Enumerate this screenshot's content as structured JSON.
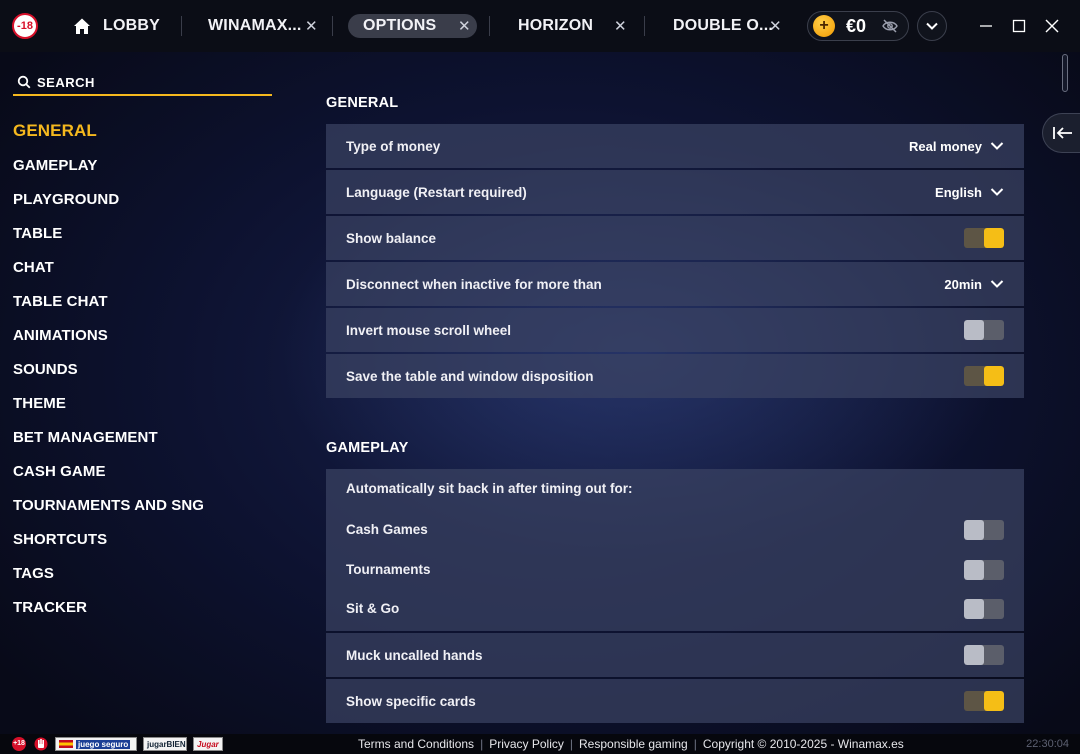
{
  "topbar": {
    "age_badge": "-18",
    "tabs": [
      {
        "label": "LOBBY",
        "icon": "home-icon",
        "closable": false
      },
      {
        "label": "WINAMAX...",
        "closable": true
      },
      {
        "label": "OPTIONS",
        "closable": true,
        "active": true
      },
      {
        "label": "HORIZON",
        "closable": true
      },
      {
        "label": "DOUBLE O...",
        "closable": true
      }
    ],
    "close_glyph": "✕",
    "wallet": {
      "coin_symbol": "+",
      "balance": "€0"
    },
    "accent_color": "#f5b81e"
  },
  "sidebar": {
    "search_placeholder": "SEARCH",
    "items": [
      {
        "label": "GENERAL",
        "active": true
      },
      {
        "label": "GAMEPLAY"
      },
      {
        "label": "PLAYGROUND"
      },
      {
        "label": "TABLE"
      },
      {
        "label": "CHAT"
      },
      {
        "label": "TABLE CHAT"
      },
      {
        "label": "ANIMATIONS"
      },
      {
        "label": "SOUNDS"
      },
      {
        "label": "THEME"
      },
      {
        "label": "BET MANAGEMENT"
      },
      {
        "label": "CASH GAME"
      },
      {
        "label": "TOURNAMENTS AND SNG"
      },
      {
        "label": "SHORTCUTS"
      },
      {
        "label": "TAGS"
      },
      {
        "label": "TRACKER"
      }
    ]
  },
  "general": {
    "title": "GENERAL",
    "rows": [
      {
        "label": "Type of money",
        "type": "select",
        "value": "Real money"
      },
      {
        "label": "Language (Restart required)",
        "type": "select",
        "value": "English"
      },
      {
        "label": "Show balance",
        "type": "toggle",
        "on": true
      },
      {
        "label": "Disconnect when inactive for more than",
        "type": "select",
        "value": "20min"
      },
      {
        "label": "Invert mouse scroll wheel",
        "type": "toggle",
        "on": false
      },
      {
        "label": "Save the table and window disposition",
        "type": "toggle",
        "on": true
      }
    ]
  },
  "gameplay": {
    "title": "GAMEPLAY",
    "group_title": "Automatically sit back in after timing out for:",
    "group_rows": [
      {
        "label": "Cash Games",
        "on": false
      },
      {
        "label": "Tournaments",
        "on": false
      },
      {
        "label": "Sit & Go",
        "on": false
      }
    ],
    "rows": [
      {
        "label": "Muck uncalled hands",
        "on": false
      },
      {
        "label": "Show specific cards",
        "on": true
      }
    ]
  },
  "footer": {
    "badge": "+18",
    "logos": [
      "juego seguro",
      "jugarBIEN",
      "Jugar"
    ],
    "links": [
      "Terms and Conditions",
      "Privacy Policy",
      "Responsible gaming"
    ],
    "copyright": "Copyright © 2010-2025 - Winamax.es",
    "clock": "22:30:04"
  }
}
